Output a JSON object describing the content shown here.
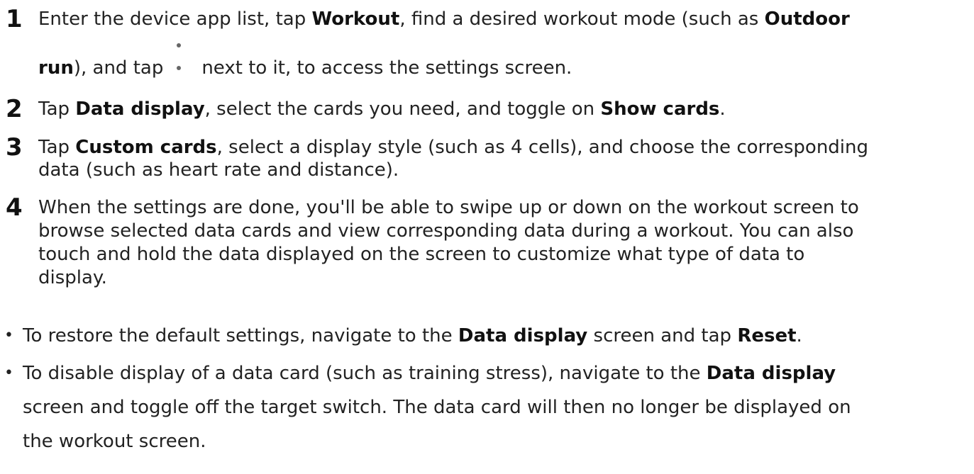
{
  "steps": [
    {
      "number": "1",
      "line1": {
        "t1": "Enter the device app list, tap ",
        "b1": "Workout",
        "t2": ", find a desired workout mode (such as ",
        "b2": "Outdoor"
      },
      "line2": {
        "b1": "run",
        "t1": "), and tap",
        "icon": "more-vertical-icon",
        "t2": "next to it, to access the settings screen."
      }
    },
    {
      "number": "2",
      "line1": {
        "t1": "Tap ",
        "b1": "Data display",
        "t2": ", select the cards you need, and toggle on ",
        "b2": "Show cards",
        "t3": "."
      }
    },
    {
      "number": "3",
      "line1": {
        "t1": "Tap ",
        "b1": "Custom cards",
        "t2": ", select a display style (such as 4 cells), and choose the corresponding"
      },
      "line2": "data (such as heart rate and distance)."
    },
    {
      "number": "4",
      "lines": [
        "When the settings are done, you'll be able to swipe up or down on the workout screen to",
        "browse selected data cards and view corresponding data during a workout. You can also",
        "touch and hold the data displayed on the screen to customize what type of data to",
        "display."
      ]
    }
  ],
  "bullets": [
    {
      "marker": "•",
      "line1": {
        "t1": "To restore the default settings, navigate to the ",
        "b1": "Data display",
        "t2": " screen and tap ",
        "b2": "Reset",
        "t3": "."
      }
    },
    {
      "marker": "•",
      "line1": {
        "t1": "To disable display of a data card (such as training stress), navigate to the ",
        "b1": "Data display"
      },
      "line2": "screen and toggle off the target switch. The data card will then no longer be displayed on",
      "line3": "the workout screen."
    }
  ]
}
